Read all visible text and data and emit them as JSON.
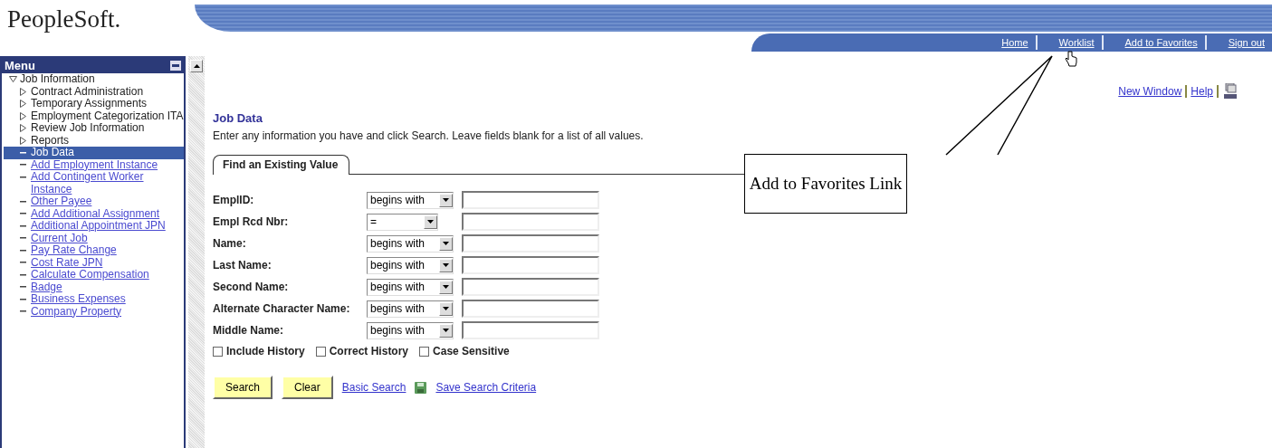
{
  "logo": "PeopleSoft.",
  "nav_links": [
    {
      "label": "Home"
    },
    {
      "label": "Worklist"
    },
    {
      "label": "Add to Favorites"
    },
    {
      "label": "Sign out"
    }
  ],
  "menu": {
    "title": "Menu",
    "items": [
      {
        "label": "Job Information",
        "kind": "folder",
        "expanded": true,
        "children": [
          {
            "label": "Contract Administration",
            "kind": "folder",
            "expanded": false
          },
          {
            "label": "Temporary Assignments",
            "kind": "folder",
            "expanded": false
          },
          {
            "label": "Employment Categorization ITA",
            "kind": "folder",
            "expanded": false
          },
          {
            "label": "Review Job Information",
            "kind": "folder",
            "expanded": false
          },
          {
            "label": "Reports",
            "kind": "folder",
            "expanded": false
          },
          {
            "label": "Job Data",
            "kind": "link",
            "selected": true
          },
          {
            "label": "Add Employment Instance",
            "kind": "link",
            "selected": false
          },
          {
            "label": "Add Contingent Worker Instance",
            "kind": "link",
            "selected": false
          },
          {
            "label": "Other Payee",
            "kind": "link",
            "selected": false
          },
          {
            "label": "Add Additional Assignment",
            "kind": "link",
            "selected": false
          },
          {
            "label": "Additional Appointment JPN",
            "kind": "link",
            "selected": false
          },
          {
            "label": "Current Job",
            "kind": "link",
            "selected": false
          },
          {
            "label": "Pay Rate Change",
            "kind": "link",
            "selected": false
          },
          {
            "label": "Cost Rate JPN",
            "kind": "link",
            "selected": false
          },
          {
            "label": "Calculate Compensation",
            "kind": "link",
            "selected": false
          },
          {
            "label": "Badge",
            "kind": "link",
            "selected": false
          },
          {
            "label": "Business Expenses",
            "kind": "link",
            "selected": false
          },
          {
            "label": "Company Property",
            "kind": "link",
            "selected": false
          }
        ]
      }
    ]
  },
  "page_links": [
    {
      "label": "New Window"
    },
    {
      "label": "Help"
    }
  ],
  "page_title": "Job Data",
  "instructions": "Enter any information you have and click Search. Leave fields blank for a list of all values.",
  "tab": {
    "label": "Find an Existing Value",
    "selected": true
  },
  "fields": [
    {
      "label": "EmplID:",
      "operator": "begins with"
    },
    {
      "label": "Empl Rcd Nbr:",
      "operator": "="
    },
    {
      "label": "Name:",
      "operator": "begins with"
    },
    {
      "label": "Last Name:",
      "operator": "begins with"
    },
    {
      "label": "Second Name:",
      "operator": "begins with"
    },
    {
      "label": "Alternate Character Name:",
      "operator": "begins with"
    },
    {
      "label": "Middle Name:",
      "operator": "begins with"
    }
  ],
  "checkboxes": [
    {
      "label": "Include History",
      "checked": false
    },
    {
      "label": "Correct History",
      "checked": false
    },
    {
      "label": "Case Sensitive",
      "checked": false
    }
  ],
  "buttons": [
    {
      "label": "Search"
    },
    {
      "label": "Clear"
    }
  ],
  "links": [
    {
      "label": "Basic Search",
      "kind": "link"
    },
    {
      "label": "Save Search Criteria",
      "kind": "save"
    }
  ],
  "callout": "Add to Favorites Link"
}
